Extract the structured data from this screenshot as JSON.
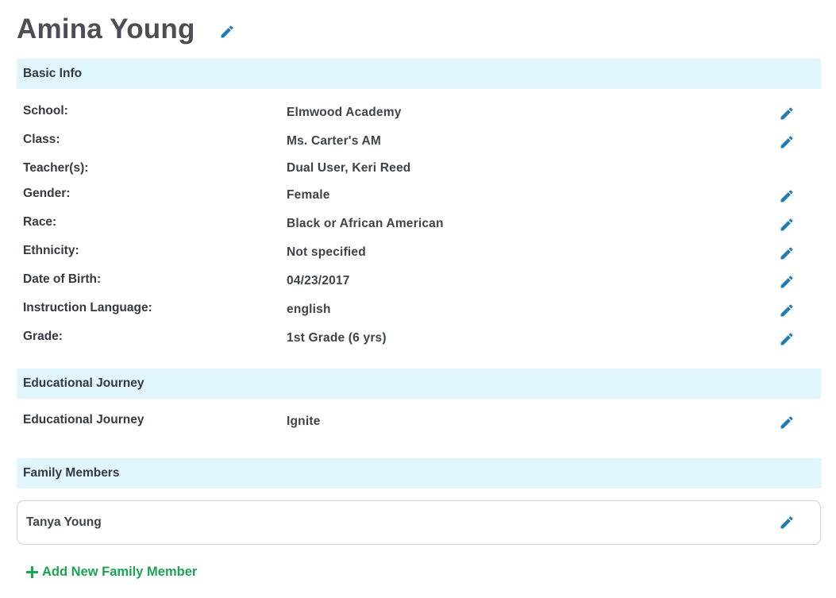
{
  "student": {
    "name": "Amina Young"
  },
  "colors": {
    "accent": "#1f7bb6",
    "section_bg": "#e0f5fc",
    "add_green": "#1aa355"
  },
  "icons": {
    "edit": "pencil-icon",
    "add": "plus-icon"
  },
  "basic_info": {
    "header": "Basic Info",
    "rows": [
      {
        "label": "School:",
        "value": "Elmwood Academy",
        "editable": true
      },
      {
        "label": "Class:",
        "value": "Ms. Carter's AM",
        "editable": true
      },
      {
        "label": "Teacher(s):",
        "value": "Dual User, Keri Reed",
        "editable": false
      },
      {
        "label": "Gender:",
        "value": "Female",
        "editable": true
      },
      {
        "label": "Race:",
        "value": "Black or African American",
        "editable": true
      },
      {
        "label": "Ethnicity:",
        "value": "Not specified",
        "editable": true
      },
      {
        "label": "Date of Birth:",
        "value": "04/23/2017",
        "editable": true
      },
      {
        "label": "Instruction Language:",
        "value": "english",
        "editable": true
      },
      {
        "label": "Grade:",
        "value": "1st Grade (6 yrs)",
        "editable": true
      }
    ]
  },
  "educational_journey": {
    "header": "Educational Journey",
    "rows": [
      {
        "label": "Educational Journey",
        "value": "Ignite",
        "editable": true
      }
    ]
  },
  "family_members": {
    "header": "Family Members",
    "members": [
      {
        "name": "Tanya Young"
      }
    ],
    "add_label": "Add New Family Member"
  }
}
